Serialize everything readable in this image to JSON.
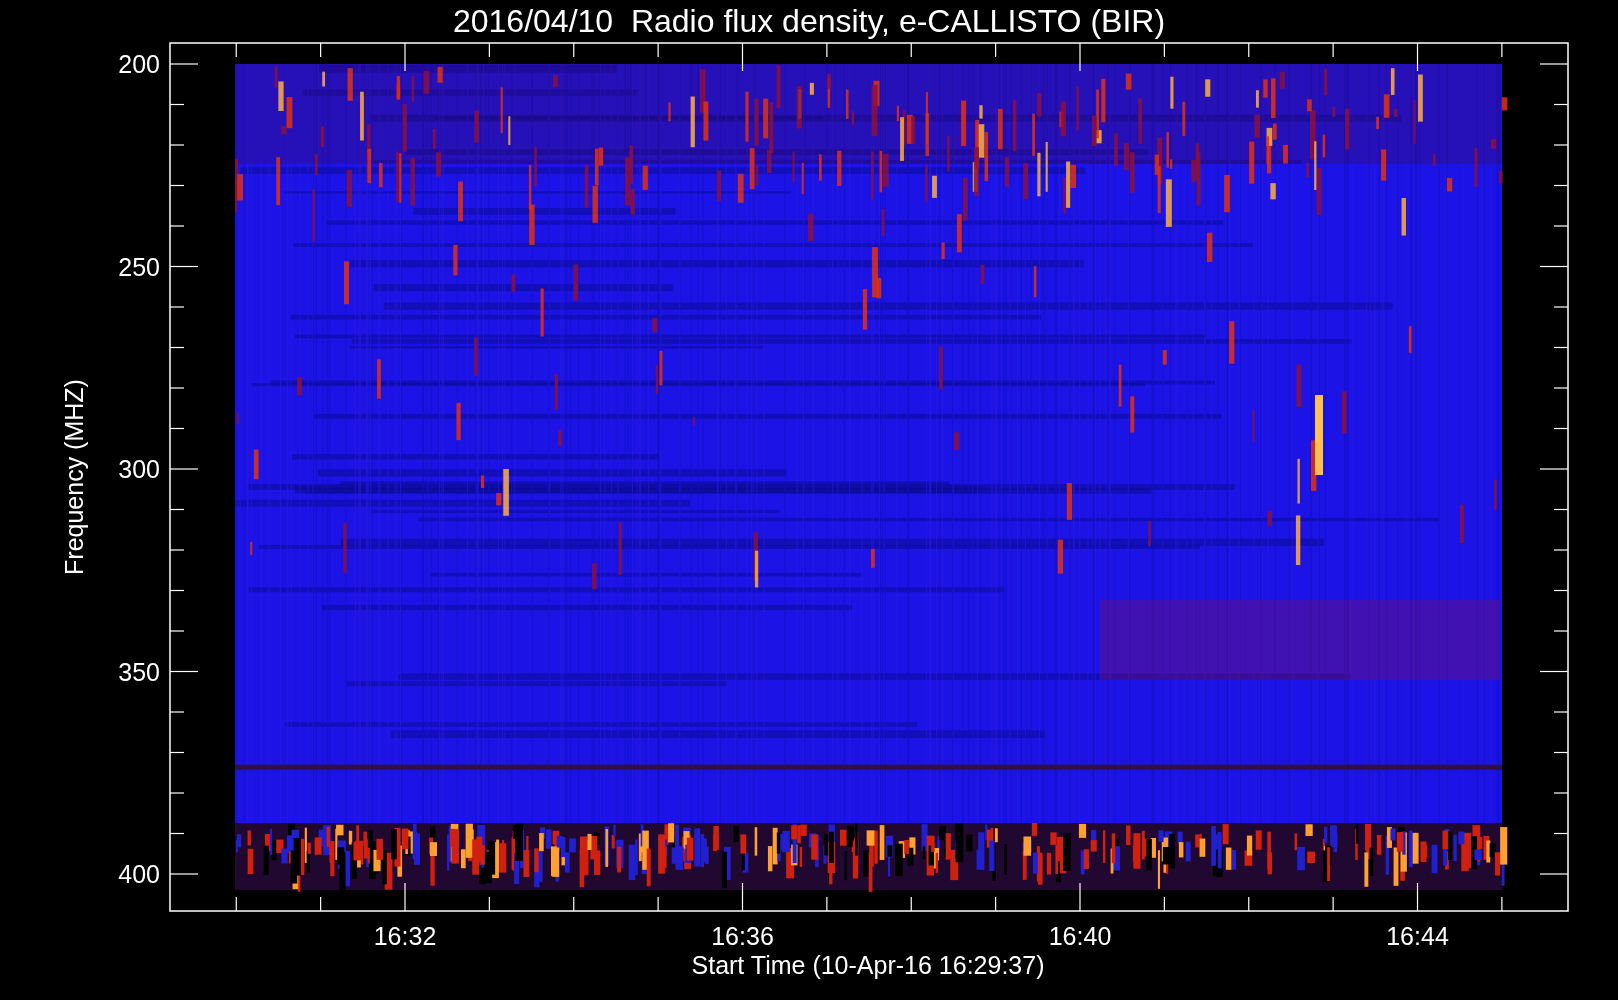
{
  "title": "2016/04/10  Radio flux density, e-CALLISTO (BIR)",
  "y_axis": {
    "label": "Frequency (MHZ)",
    "ticks": [
      "200",
      "250",
      "300",
      "350",
      "400"
    ]
  },
  "x_axis": {
    "label": "Start Time (10-Apr-16 16:29:37)",
    "ticks": [
      "16:32",
      "16:36",
      "16:40",
      "16:44"
    ]
  }
}
